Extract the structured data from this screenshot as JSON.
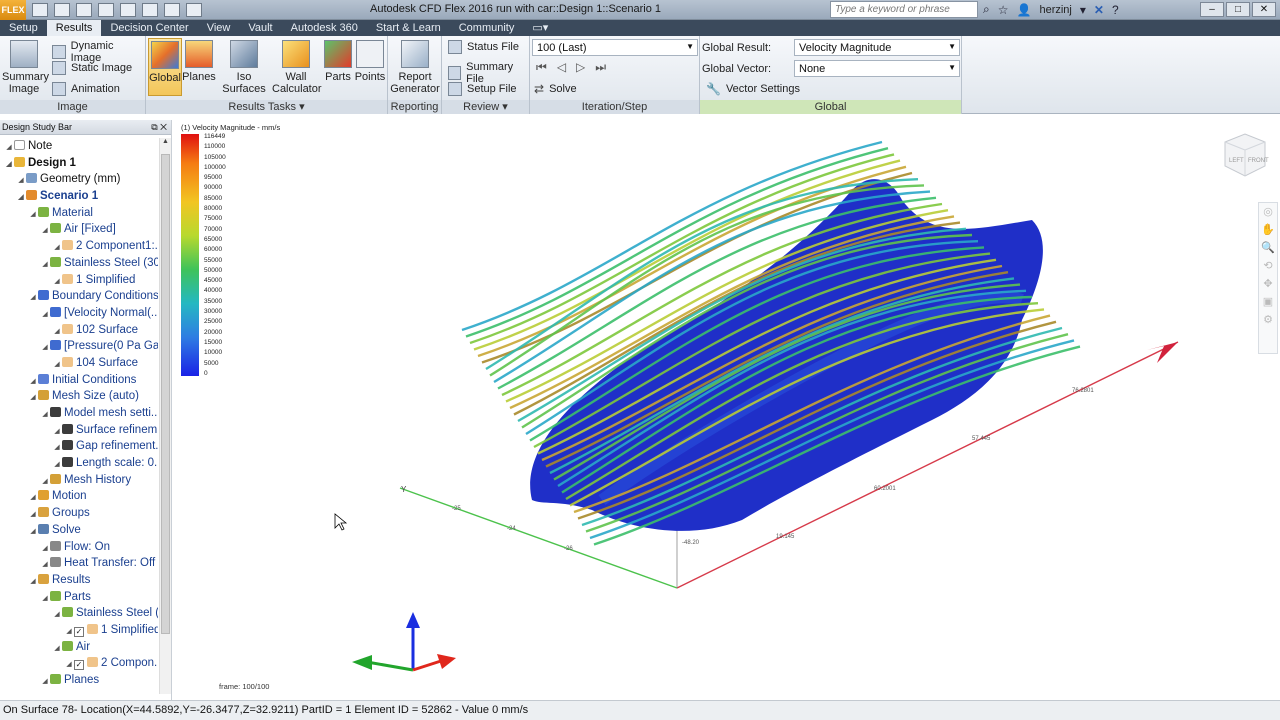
{
  "window": {
    "app_badge": "FLEX",
    "title": "Autodesk CFD Flex 2016   run with car::Design 1::Scenario 1",
    "search_placeholder": "Type a keyword or phrase",
    "user": "herzinj"
  },
  "tabs": [
    "Setup",
    "Results",
    "Decision Center",
    "View",
    "Vault",
    "Autodesk 360",
    "Start & Learn",
    "Community"
  ],
  "ribbon": {
    "image_panel": {
      "label": "Image",
      "summary_image": "Summary Image",
      "dynamic_image": "Dynamic Image",
      "static_image": "Static Image",
      "animation": "Animation"
    },
    "results_tasks_panel": {
      "label": "Results Tasks ▾",
      "global": "Global",
      "planes": "Planes",
      "iso_surfaces": "Iso Surfaces",
      "wall_calculator": "Wall Calculator",
      "parts": "Parts",
      "points": "Points"
    },
    "reporting_panel": {
      "label": "Reporting",
      "report_generator": "Report Generator"
    },
    "review_panel": {
      "label": "Review ▾",
      "status_file": "Status File",
      "summary_file": "Summary File",
      "setup_file": "Setup File"
    },
    "iteration_panel": {
      "label": "Iteration/Step",
      "step_value": "100 (Last)",
      "solve": "Solve"
    },
    "global_panel": {
      "label": "Global",
      "global_result_label": "Global Result:",
      "global_result_value": "Velocity Magnitude",
      "global_vector_label": "Global Vector:",
      "global_vector_value": "None",
      "vector_settings": "Vector Settings"
    }
  },
  "sidebar": {
    "title": "Design Study Bar",
    "tree": [
      {
        "label": "Note",
        "level": 0,
        "style": "black",
        "icon": "note"
      },
      {
        "label": "Design 1",
        "level": 0,
        "style": "black-bold",
        "icon": "design"
      },
      {
        "label": "Geometry (mm)",
        "level": 1,
        "style": "black",
        "icon": "geometry"
      },
      {
        "label": "Scenario 1",
        "level": 1,
        "style": "bold",
        "icon": "scenario"
      },
      {
        "label": "Material",
        "level": 2,
        "icon": "material"
      },
      {
        "label": "Air [Fixed]",
        "level": 3,
        "icon": "material"
      },
      {
        "label": "2 Component1:...",
        "level": 4,
        "icon": "part"
      },
      {
        "label": "Stainless Steel (30...",
        "level": 3,
        "icon": "material"
      },
      {
        "label": "1 Simplified",
        "level": 4,
        "icon": "part"
      },
      {
        "label": "Boundary Conditions",
        "level": 2,
        "icon": "bc"
      },
      {
        "label": "[Velocity Normal(...",
        "level": 3,
        "icon": "bc"
      },
      {
        "label": "102 Surface",
        "level": 4,
        "icon": "part"
      },
      {
        "label": "[Pressure(0 Pa Ga...",
        "level": 3,
        "icon": "bc"
      },
      {
        "label": "104 Surface",
        "level": 4,
        "icon": "part"
      },
      {
        "label": "Initial Conditions",
        "level": 2,
        "icon": "ic"
      },
      {
        "label": "Mesh Size (auto)",
        "level": 2,
        "icon": "mesh"
      },
      {
        "label": "Model mesh setti...",
        "level": 3,
        "icon": "info"
      },
      {
        "label": "Surface refinem...",
        "level": 4,
        "icon": "info"
      },
      {
        "label": "Gap refinement...",
        "level": 4,
        "icon": "info"
      },
      {
        "label": "Length scale: 0....",
        "level": 4,
        "icon": "info"
      },
      {
        "label": "Mesh History",
        "level": 3,
        "icon": "mesh"
      },
      {
        "label": "Motion",
        "level": 2,
        "icon": "motion"
      },
      {
        "label": "Groups",
        "level": 2,
        "icon": "groups"
      },
      {
        "label": "Solve",
        "level": 2,
        "icon": "solve"
      },
      {
        "label": "Flow: On",
        "level": 3,
        "icon": "flow"
      },
      {
        "label": "Heat Transfer: Off",
        "level": 3,
        "icon": "flow"
      },
      {
        "label": "Results",
        "level": 2,
        "icon": "results"
      },
      {
        "label": "Parts",
        "level": 3,
        "icon": "material"
      },
      {
        "label": "Stainless Steel (...",
        "level": 4,
        "icon": "material"
      },
      {
        "label": "1 Simplified",
        "level": 5,
        "icon": "part",
        "checkbox": true
      },
      {
        "label": "Air",
        "level": 4,
        "icon": "material"
      },
      {
        "label": "2 Compon...",
        "level": 5,
        "icon": "part",
        "checkbox": true
      },
      {
        "label": "Planes",
        "level": 3,
        "icon": "material"
      }
    ]
  },
  "viewport": {
    "legend_title": "(1) Velocity Magnitude - mm/s",
    "legend_values": [
      "116449",
      "110000",
      "105000",
      "100000",
      "95000",
      "90000",
      "85000",
      "80000",
      "75000",
      "70000",
      "65000",
      "60000",
      "55000",
      "50000",
      "45000",
      "40000",
      "35000",
      "30000",
      "25000",
      "20000",
      "15000",
      "10000",
      "5000",
      "0"
    ],
    "frame_text": "frame: 100/100",
    "viewcube_left": "LEFT",
    "viewcube_front": "FRONT",
    "axis_labels": {
      "y": "Y",
      "tick_a": "-25",
      "tick_b": "-24",
      "tick_c": "-26",
      "tick_d": "-48.20",
      "tick_e": "19.145",
      "tick_f": "60.2001",
      "tick_g": "57.445",
      "tick_h": "76.2801"
    }
  },
  "statusbar": {
    "text": "On Surface 78- Location(X=44.5892,Y=-26.3477,Z=32.9211) PartID = 1 Element ID = 52862 - Value 0  mm/s"
  }
}
